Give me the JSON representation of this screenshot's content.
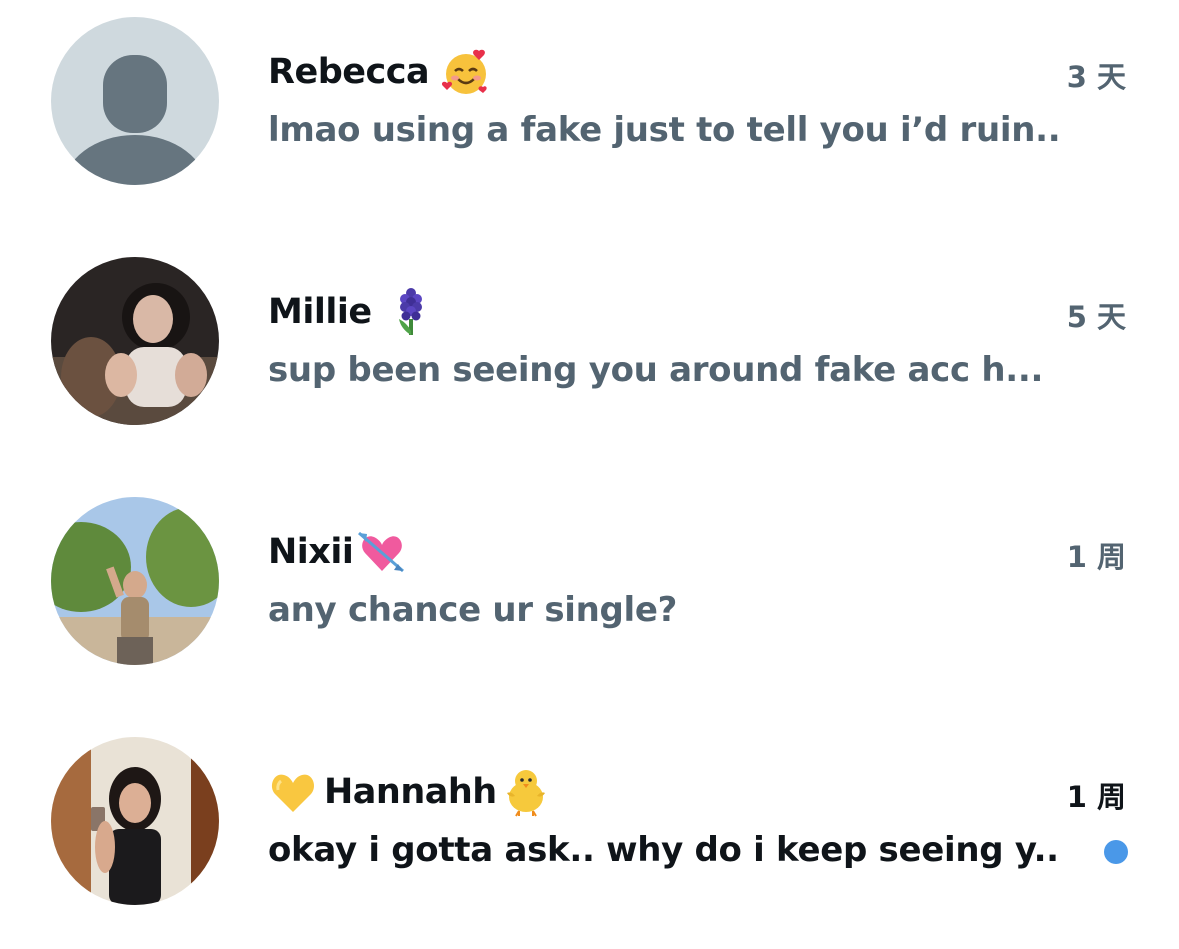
{
  "conversations": [
    {
      "name": "Rebecca",
      "name_emoji": "smiling-face-with-hearts-emoji",
      "time": "3 天",
      "preview": "lmao using a fake just to tell you i’d ruin...",
      "avatar": "default-avatar",
      "unread": false
    },
    {
      "name": "Millie",
      "name_emoji": "hyacinth-emoji",
      "time": "5 天",
      "preview": "sup been seeing you around fake acc h...",
      "avatar": "photo-avatar",
      "unread": false
    },
    {
      "name": "Nixii",
      "name_emoji": "heart-with-arrow-emoji",
      "time": "1 周",
      "preview": "any chance ur single?",
      "avatar": "photo-avatar",
      "unread": false
    },
    {
      "name": "Hannahh",
      "name_prefix_emoji": "yellow-heart-emoji",
      "name_emoji": "front-facing-baby-chick-emoji",
      "time": "1 周",
      "preview": "okay i gotta ask.. why do i keep seeing y...",
      "avatar": "photo-avatar",
      "unread": true
    }
  ],
  "colors": {
    "primary_text": "#0f1419",
    "secondary_text": "#536471",
    "unread_dot": "#4a98e8",
    "background": "#ffffff"
  }
}
